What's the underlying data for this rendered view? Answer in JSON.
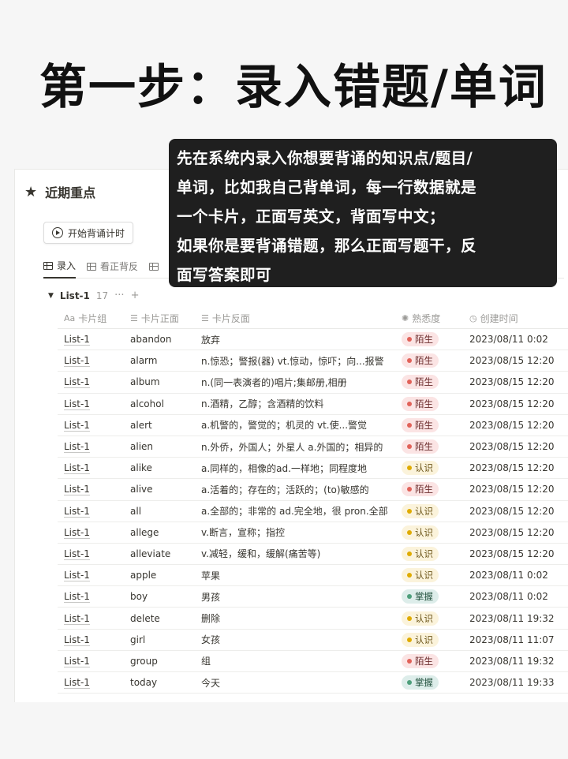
{
  "headline": "第一步：录入错题/单词",
  "page": {
    "title": "近期重点",
    "timer_button": "开始背诵计时",
    "tabs": [
      {
        "label": "录入"
      },
      {
        "label": "看正背反"
      },
      {
        "label": ""
      }
    ]
  },
  "group": {
    "name": "List-1",
    "count": "17",
    "more": "···",
    "add": "+"
  },
  "columns": {
    "group": "卡片组",
    "group_prefix": "Aa",
    "front": "卡片正面",
    "back": "卡片反面",
    "familiarity": "熟悉度",
    "created": "创建时间"
  },
  "status_colors": {
    "陌生": {
      "bg": "#fbe4e4",
      "dot": "#e16259",
      "text": "#6b2b2b"
    },
    "认识": {
      "bg": "#fbf3db",
      "dot": "#dfab01",
      "text": "#6b5417"
    },
    "掌握": {
      "bg": "#ddedea",
      "dot": "#4d9f7b",
      "text": "#1f4f3b"
    }
  },
  "rows": [
    {
      "group": "List-1",
      "front": "abandon",
      "back": "放弃",
      "status": "陌生",
      "created": "2023/08/11 0:02"
    },
    {
      "group": "List-1",
      "front": "alarm",
      "back": "n.惊恐；警报(器) vt.惊动，惊吓；向...报警",
      "status": "陌生",
      "created": "2023/08/15 12:20"
    },
    {
      "group": "List-1",
      "front": "album",
      "back": "n.(同一表演者的)唱片;集邮册,相册",
      "status": "陌生",
      "created": "2023/08/15 12:20"
    },
    {
      "group": "List-1",
      "front": "alcohol",
      "back": "n.酒精，乙醇；含酒精的饮料",
      "status": "陌生",
      "created": "2023/08/15 12:20"
    },
    {
      "group": "List-1",
      "front": "alert",
      "back": "a.机警的，警觉的；机灵的 vt.使...警觉",
      "status": "陌生",
      "created": "2023/08/15 12:20"
    },
    {
      "group": "List-1",
      "front": "alien",
      "back": "n.外侨，外国人；外星人 a.外国的；相异的",
      "status": "陌生",
      "created": "2023/08/15 12:20"
    },
    {
      "group": "List-1",
      "front": "alike",
      "back": "a.同样的，相像的ad.一样地；同程度地",
      "status": "认识",
      "created": "2023/08/15 12:20"
    },
    {
      "group": "List-1",
      "front": "alive",
      "back": "a.活着的；存在的；活跃的；(to)敏感的",
      "status": "陌生",
      "created": "2023/08/15 12:20"
    },
    {
      "group": "List-1",
      "front": "all",
      "back": "a.全部的；非常的 ad.完全地，很 pron.全部",
      "status": "认识",
      "created": "2023/08/15 12:20"
    },
    {
      "group": "List-1",
      "front": "allege",
      "back": "v.断言，宣称；指控",
      "status": "认识",
      "created": "2023/08/15 12:20"
    },
    {
      "group": "List-1",
      "front": "alleviate",
      "back": "v.减轻，缓和，缓解(痛苦等)",
      "status": "认识",
      "created": "2023/08/15 12:20"
    },
    {
      "group": "List-1",
      "front": "apple",
      "back": "苹果",
      "status": "认识",
      "created": "2023/08/11 0:02"
    },
    {
      "group": "List-1",
      "front": "boy",
      "back": "男孩",
      "status": "掌握",
      "created": "2023/08/11 0:02"
    },
    {
      "group": "List-1",
      "front": "delete",
      "back": "删除",
      "status": "认识",
      "created": "2023/08/11 19:32"
    },
    {
      "group": "List-1",
      "front": "girl",
      "back": "女孩",
      "status": "认识",
      "created": "2023/08/11 11:07"
    },
    {
      "group": "List-1",
      "front": "group",
      "back": "组",
      "status": "陌生",
      "created": "2023/08/11 19:32"
    },
    {
      "group": "List-1",
      "front": "today",
      "back": "今天",
      "status": "掌握",
      "created": "2023/08/11 19:33"
    }
  ],
  "callout_lines": [
    "先在系统内录入你想要背诵的知识点/题目/",
    "单词，比如我自己背单词，每一行数据就是",
    "一个卡片，正面写英文，背面写中文；",
    "如果你是要背诵错题，那么正面写题干，反",
    "面写答案即可"
  ]
}
